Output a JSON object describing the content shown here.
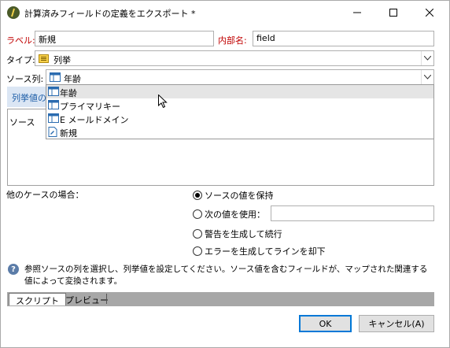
{
  "window": {
    "title": "計算済みフィールドの定義をエクスポート *"
  },
  "form": {
    "label_caption": "ラベル:",
    "label_value": "新規",
    "internal_name_caption": "内部名:",
    "internal_name_value": "field",
    "type_caption": "タイプ:",
    "type_value": "列挙",
    "source_column_caption": "ソース列:",
    "source_column_value": "年齢",
    "enum_hint": "列挙値の",
    "grid_header": "ソース"
  },
  "dropdown": {
    "items": [
      {
        "label": "年齢",
        "icon": "column-icon"
      },
      {
        "label": "プライマリキー",
        "icon": "column-icon"
      },
      {
        "label": "E メールドメイン",
        "icon": "column-icon"
      },
      {
        "label": "新規",
        "icon": "document-icon"
      }
    ]
  },
  "other_cases": {
    "caption": "他のケースの場合：",
    "options": [
      {
        "label": "ソースの値を保持",
        "selected": true
      },
      {
        "label": "次の値を使用：",
        "selected": false
      },
      {
        "label": "警告を生成して続行",
        "selected": false
      },
      {
        "label": "エラーを生成してラインを却下",
        "selected": false
      }
    ]
  },
  "info": {
    "text": "参照ソースの列を選択し、列挙値を設定してください。ソース値を含むフィールドが、マップされた関連する値によって変換されます。"
  },
  "tabs": [
    "スクリプト",
    "プレビュー"
  ],
  "buttons": {
    "ok": "OK",
    "cancel": "キャンセル(A)"
  },
  "colors": {
    "required_label": "#c00000",
    "link_blue": "#1f5fa8",
    "focus_border": "#0078d7"
  }
}
